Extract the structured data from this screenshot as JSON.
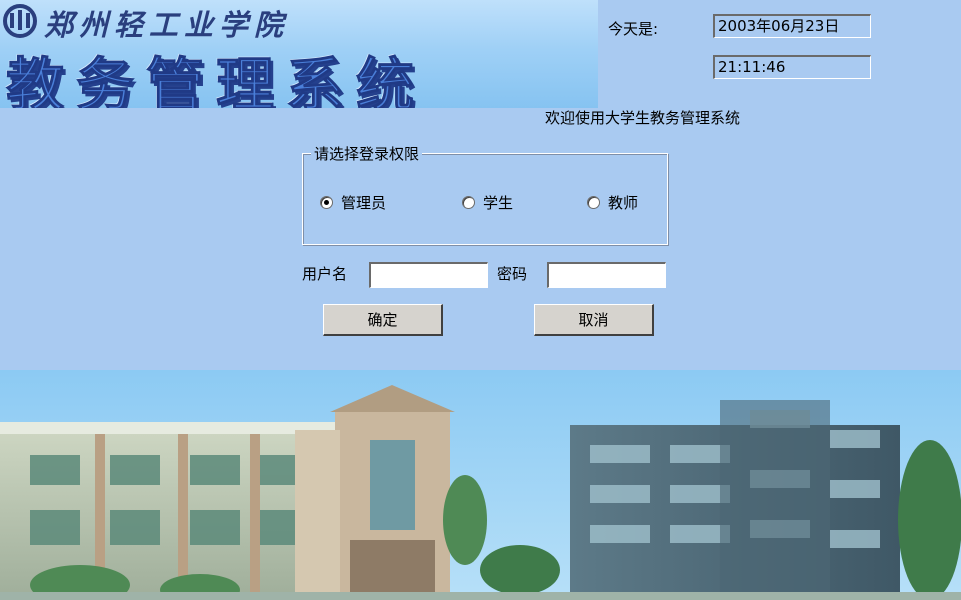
{
  "header": {
    "school_name": "郑州轻工业学院",
    "system_title": "教务管理系统"
  },
  "datetime": {
    "today_label": "今天是:",
    "date": "2003年06月23日",
    "time": "21:11:46"
  },
  "welcome": "欢迎使用大学生教务管理系统",
  "role_group": {
    "legend": "请选择登录权限",
    "options": [
      {
        "label": "管理员",
        "checked": true
      },
      {
        "label": "学生",
        "checked": false
      },
      {
        "label": "教师",
        "checked": false
      }
    ]
  },
  "credentials": {
    "username_label": "用户名",
    "username_value": "",
    "password_label": "密码",
    "password_value": ""
  },
  "buttons": {
    "ok": "确定",
    "cancel": "取消"
  },
  "colors": {
    "background": "#a9caf1",
    "banner": "#9fd0f6",
    "title_blue": "#4a7fd9",
    "button_face": "#d6d3ce"
  }
}
